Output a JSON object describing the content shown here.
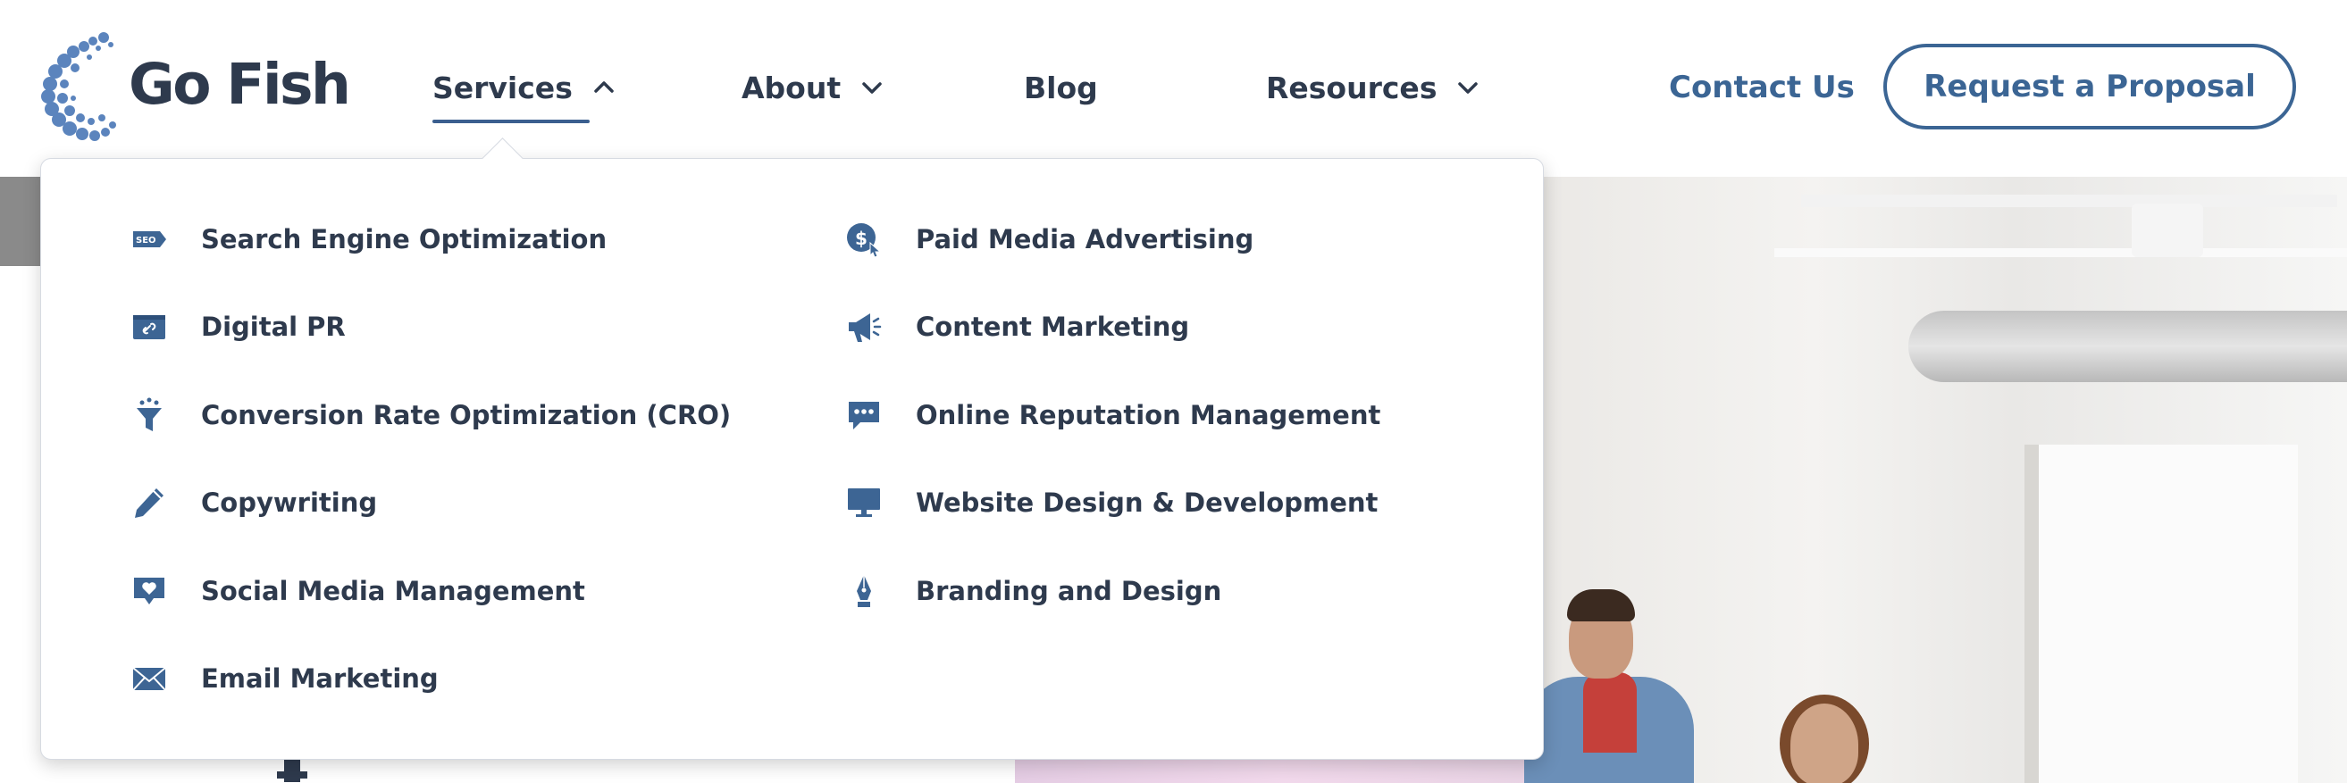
{
  "brand": {
    "name": "Go Fish",
    "logo_icon": "fish-bubbles-logo",
    "color": "#2e3a4d"
  },
  "nav": {
    "items": [
      {
        "label": "Services",
        "icon": "chevron-up-icon",
        "active": true
      },
      {
        "label": "About",
        "icon": "chevron-down-icon"
      },
      {
        "label": "Blog"
      },
      {
        "label": "Resources",
        "icon": "chevron-down-icon"
      }
    ],
    "contact_label": "Contact Us",
    "cta_label": "Request a Proposal",
    "accent_color": "#3b6594"
  },
  "services_menu": {
    "left": [
      {
        "label": "Search Engine Optimization",
        "icon": "seo-tag-icon"
      },
      {
        "label": "Digital PR",
        "icon": "link-card-icon"
      },
      {
        "label": "Conversion Rate Optimization (CRO)",
        "icon": "funnel-icon"
      },
      {
        "label": "Copywriting",
        "icon": "pencil-icon"
      },
      {
        "label": "Social Media Management",
        "icon": "heart-message-icon"
      },
      {
        "label": "Email Marketing",
        "icon": "envelope-icon"
      }
    ],
    "right": [
      {
        "label": "Paid Media Advertising",
        "icon": "dollar-cursor-icon"
      },
      {
        "label": "Content Marketing",
        "icon": "megaphone-icon"
      },
      {
        "label": "Online Reputation Management",
        "icon": "chat-bubble-icon"
      },
      {
        "label": "Website Design & Development",
        "icon": "monitor-icon"
      },
      {
        "label": "Branding and Design",
        "icon": "pen-nib-icon"
      }
    ],
    "icon_color": "#3d6594"
  }
}
